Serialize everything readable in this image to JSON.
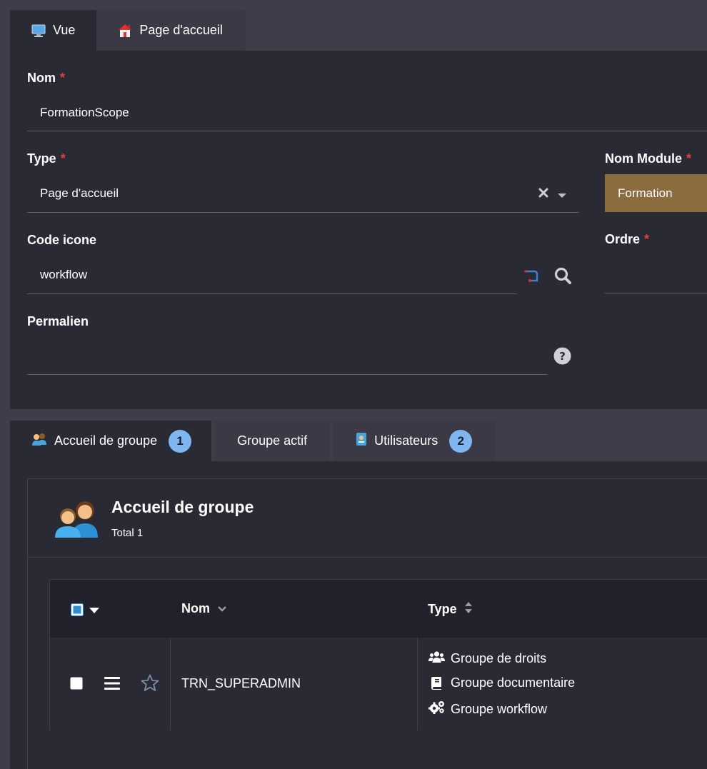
{
  "top_tabs": [
    {
      "label": "Vue",
      "icon": "monitor-icon",
      "active": true
    },
    {
      "label": "Page d'accueil",
      "icon": "home-icon",
      "active": false
    }
  ],
  "form": {
    "nom": {
      "label": "Nom",
      "required": "*",
      "value": "FormationScope"
    },
    "type": {
      "label": "Type",
      "required": "*",
      "value": "Page d'accueil"
    },
    "nom_module": {
      "label": "Nom Module",
      "required": "*",
      "value": "Formation"
    },
    "code_icone": {
      "label": "Code icone",
      "value": "workflow"
    },
    "ordre": {
      "label": "Ordre",
      "required": "*",
      "value": ""
    },
    "permalien": {
      "label": "Permalien",
      "value": ""
    }
  },
  "lower_tabs": [
    {
      "label": "Accueil de groupe",
      "badge": "1",
      "icon": "group-icon",
      "active": true
    },
    {
      "label": "Groupe actif",
      "badge": "",
      "active": false
    },
    {
      "label": "Utilisateurs",
      "badge": "2",
      "icon": "user-card-icon",
      "active": false
    }
  ],
  "card": {
    "title": "Accueil de groupe",
    "subtitle": "Total 1"
  },
  "table": {
    "columns": {
      "nom": "Nom",
      "type": "Type"
    },
    "rows": [
      {
        "nom": "TRN_SUPERADMIN",
        "types": [
          "Groupe de droits",
          "Groupe documentaire",
          "Groupe workflow"
        ]
      }
    ]
  },
  "colors": {
    "accent_module": "#8b6c3f",
    "badge": "#7fb6f0",
    "required": "#e0413a",
    "panel": "#2a2a35"
  }
}
